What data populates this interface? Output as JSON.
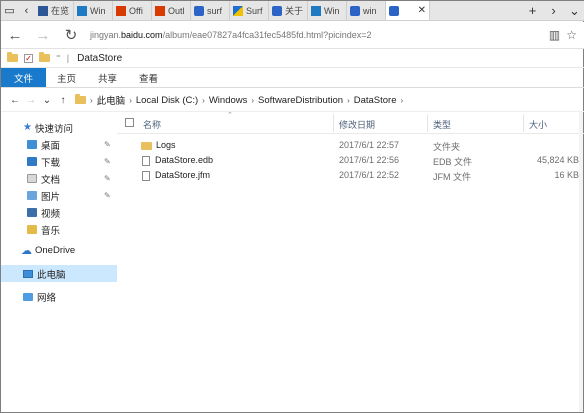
{
  "browser": {
    "tabs": [
      {
        "label": "在览",
        "favicon": "word-icon"
      },
      {
        "label": "Win",
        "favicon": "windows-icon"
      },
      {
        "label": "Offi",
        "favicon": "office-icon"
      },
      {
        "label": "Outl",
        "favicon": "office-icon"
      },
      {
        "label": "surf",
        "favicon": "baidu-paw-icon"
      },
      {
        "label": "Surf",
        "favicon": "surface-icon"
      },
      {
        "label": "关于",
        "favicon": "baidu-paw-icon"
      },
      {
        "label": "Win",
        "favicon": "windows-icon"
      },
      {
        "label": "win",
        "favicon": "baidu-paw-icon"
      },
      {
        "label": "",
        "favicon": "baidu-paw-icon",
        "active": true
      }
    ],
    "url_prefix": "jingyan.",
    "url_host": "baidu.com",
    "url_path": "/album/eae07827a4fca31fec5485fd.html?picindex=2"
  },
  "explorer": {
    "window_title": "DataStore",
    "ribbon_tabs": [
      "文件",
      "主页",
      "共享",
      "查看"
    ],
    "breadcrumbs": [
      "此电脑",
      "Local Disk (C:)",
      "Windows",
      "SoftwareDistribution",
      "DataStore"
    ],
    "nav": {
      "quick_access": "快速访问",
      "pinned": [
        "桌面",
        "下载",
        "文档",
        "图片"
      ],
      "others": [
        "视频",
        "音乐"
      ],
      "onedrive": "OneDrive",
      "this_pc": "此电脑",
      "network": "网络"
    },
    "columns": {
      "name": "名称",
      "date": "修改日期",
      "type": "类型",
      "size": "大小"
    },
    "files": [
      {
        "name": "Logs",
        "date": "2017/6/1 22:57",
        "type": "文件夹",
        "size": "",
        "kind": "folder"
      },
      {
        "name": "DataStore.edb",
        "date": "2017/6/1 22:56",
        "type": "EDB 文件",
        "size": "45,824 KB",
        "kind": "file"
      },
      {
        "name": "DataStore.jfm",
        "date": "2017/6/1 22:52",
        "type": "JFM 文件",
        "size": "16 KB",
        "kind": "file"
      }
    ]
  }
}
